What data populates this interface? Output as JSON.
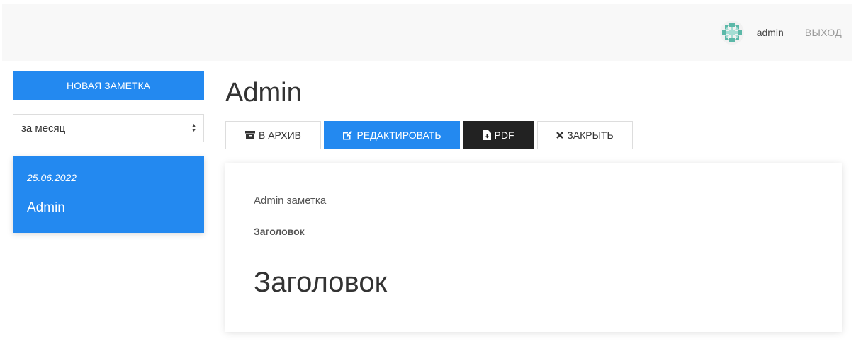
{
  "header": {
    "username": "admin",
    "logout_label": "ВЫХОД",
    "avatar_icon": "identicon-avatar"
  },
  "sidebar": {
    "new_note_label": "НОВАЯ ЗАМЕТКА",
    "period_select": {
      "value": "за месяц"
    },
    "notes": [
      {
        "date": "25.06.2022",
        "title": "Admin"
      }
    ]
  },
  "main": {
    "title": "Admin",
    "toolbar": {
      "archive_label": "В АРХИВ",
      "edit_label": "РЕДАКТИРОВАТЬ",
      "pdf_label": "PDF",
      "close_label": "ЗАКРЫТЬ"
    },
    "content": {
      "subtitle": "Admin заметка",
      "bold_heading": "Заголовок",
      "heading": "Заголовок"
    }
  },
  "colors": {
    "accent": "#2389f0",
    "dark": "#222222",
    "topbar_bg": "#f8f8f8"
  }
}
